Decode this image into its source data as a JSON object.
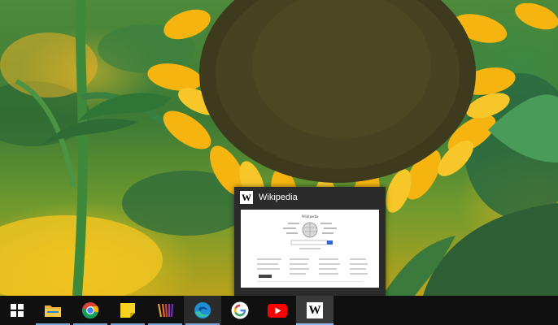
{
  "taskbar": {
    "items": [
      {
        "name": "start",
        "icon": "windows-logo-icon"
      },
      {
        "name": "file-explorer",
        "icon": "folder-icon",
        "running": true
      },
      {
        "name": "chrome",
        "icon": "chrome-icon",
        "running": true
      },
      {
        "name": "sticky-notes",
        "icon": "sticky-notes-icon",
        "running": true
      },
      {
        "name": "wacom",
        "icon": "wacom-icon",
        "running": true
      },
      {
        "name": "edge",
        "icon": "edge-icon",
        "running": true,
        "state": "hover"
      },
      {
        "name": "google",
        "icon": "google-icon"
      },
      {
        "name": "youtube",
        "icon": "youtube-icon"
      },
      {
        "name": "wikipedia",
        "icon": "wikipedia-icon",
        "running": true,
        "state": "active"
      }
    ]
  },
  "preview": {
    "title": "Wikipedia",
    "app_icon_glyph": "W",
    "page_heading": "Wikipedia"
  },
  "colors": {
    "taskbar_bg": "#101010",
    "preview_bg": "#2b2b2b",
    "running_indicator": "#7aa7d6"
  }
}
